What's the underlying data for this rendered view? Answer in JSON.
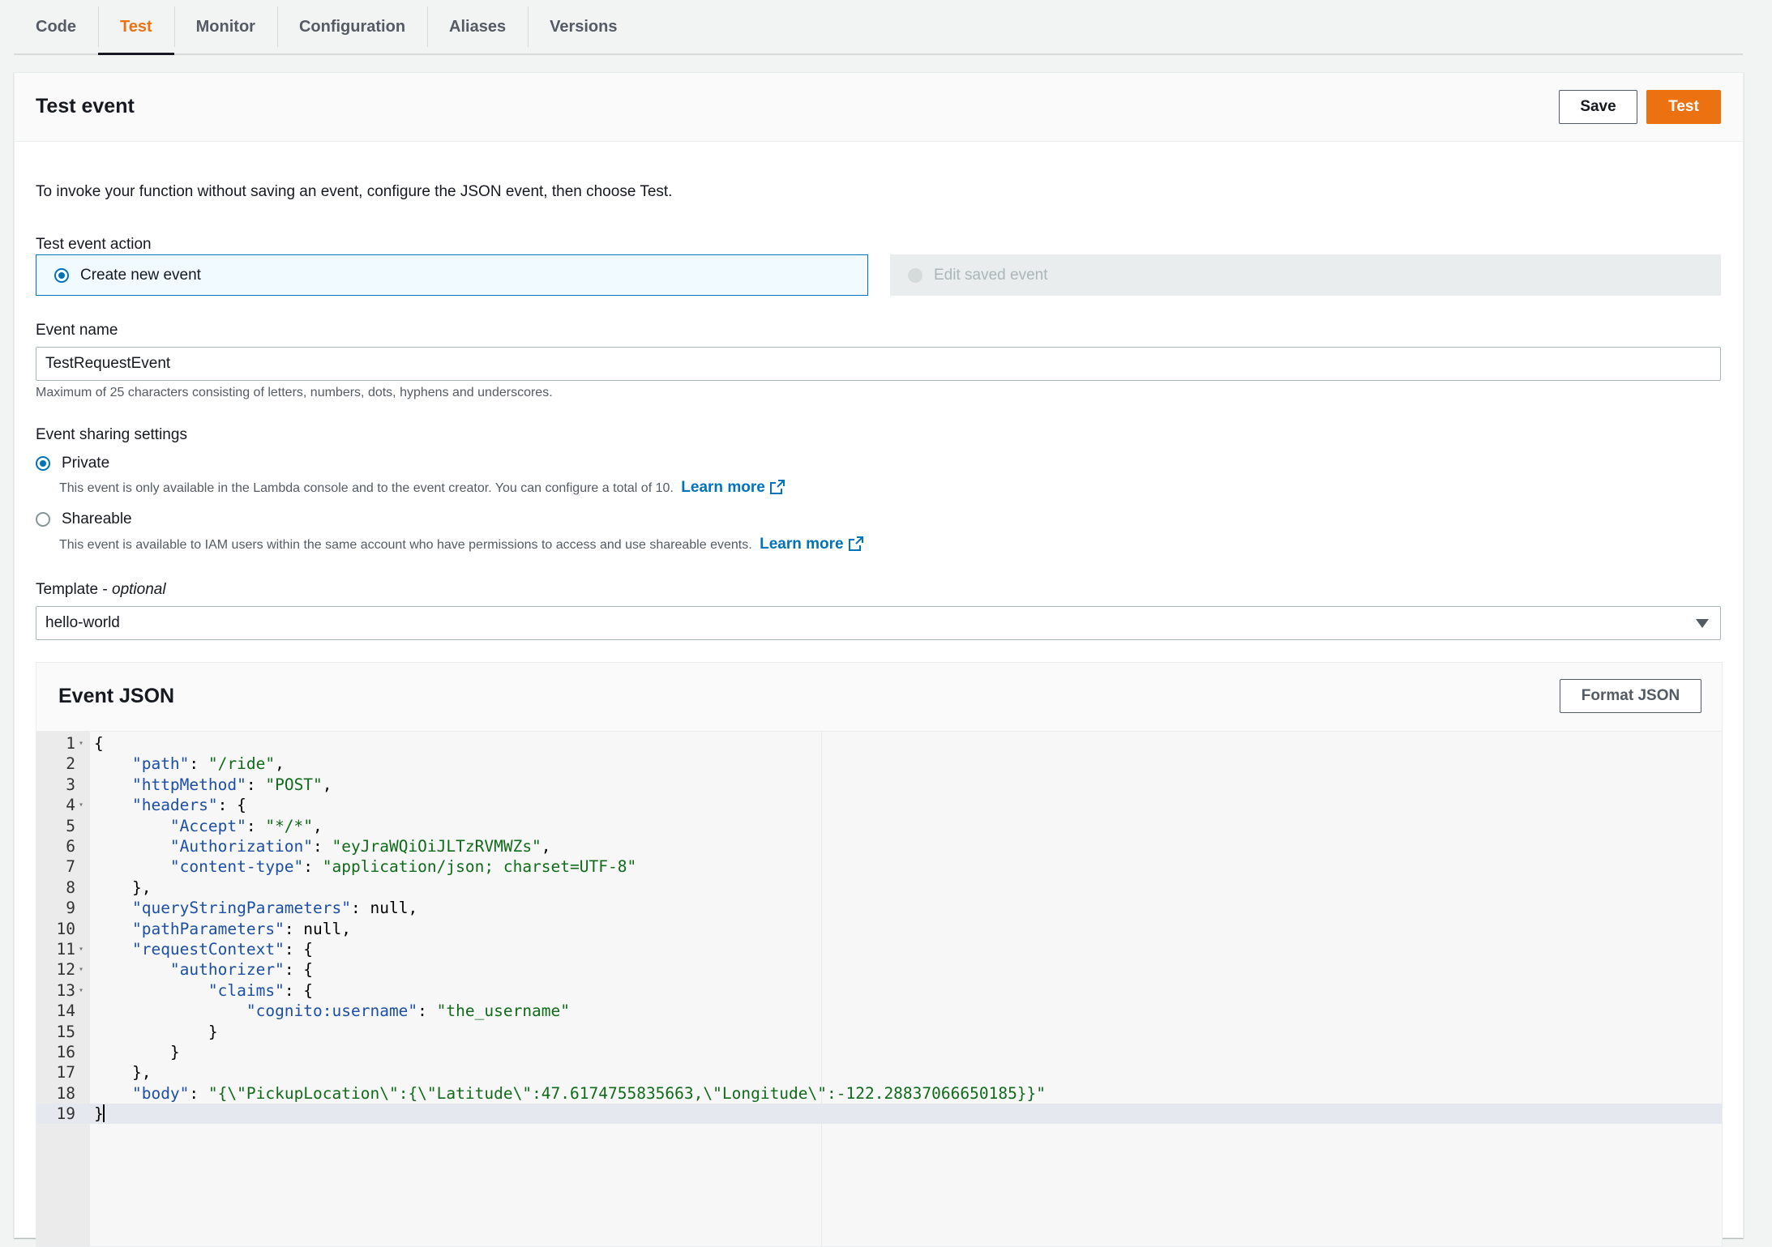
{
  "tabs": [
    {
      "label": "Code"
    },
    {
      "label": "Test",
      "active": true
    },
    {
      "label": "Monitor"
    },
    {
      "label": "Configuration"
    },
    {
      "label": "Aliases"
    },
    {
      "label": "Versions"
    }
  ],
  "panel": {
    "title": "Test event",
    "save_label": "Save",
    "test_label": "Test",
    "intro": "To invoke your function without saving an event, configure the JSON event, then choose Test."
  },
  "test_event_action": {
    "label": "Test event action",
    "create_new": "Create new event",
    "edit_saved": "Edit saved event",
    "selected": "Create new event"
  },
  "event_name": {
    "label": "Event name",
    "value": "TestRequestEvent",
    "hint": "Maximum of 25 characters consisting of letters, numbers, dots, hyphens and underscores."
  },
  "sharing": {
    "label": "Event sharing settings",
    "private_label": "Private",
    "private_desc": "This event is only available in the Lambda console and to the event creator. You can configure a total of 10.",
    "shareable_label": "Shareable",
    "shareable_desc": "This event is available to IAM users within the same account who have permissions to access and use shareable events.",
    "learn_more": "Learn more",
    "selected": "Private"
  },
  "template": {
    "label": "Template",
    "label_suffix": "optional",
    "value": "hello-world"
  },
  "event_json": {
    "title": "Event JSON",
    "format_label": "Format JSON",
    "active_line": 19,
    "lines": [
      {
        "n": "1",
        "fold": true,
        "indent": 0,
        "parts": [
          [
            "p",
            "{"
          ]
        ]
      },
      {
        "n": "2",
        "indent": 1,
        "parts": [
          [
            "k",
            "\"path\""
          ],
          [
            "p",
            ": "
          ],
          [
            "s",
            "\"/ride\""
          ],
          [
            "p",
            ","
          ]
        ]
      },
      {
        "n": "3",
        "indent": 1,
        "parts": [
          [
            "k",
            "\"httpMethod\""
          ],
          [
            "p",
            ": "
          ],
          [
            "s",
            "\"POST\""
          ],
          [
            "p",
            ","
          ]
        ]
      },
      {
        "n": "4",
        "fold": true,
        "indent": 1,
        "parts": [
          [
            "k",
            "\"headers\""
          ],
          [
            "p",
            ": {"
          ]
        ]
      },
      {
        "n": "5",
        "indent": 2,
        "parts": [
          [
            "k",
            "\"Accept\""
          ],
          [
            "p",
            ": "
          ],
          [
            "s",
            "\"*/*\""
          ],
          [
            "p",
            ","
          ]
        ]
      },
      {
        "n": "6",
        "indent": 2,
        "parts": [
          [
            "k",
            "\"Authorization\""
          ],
          [
            "p",
            ": "
          ],
          [
            "s",
            "\"eyJraWQiOiJLTzRVMWZs\""
          ],
          [
            "p",
            ","
          ]
        ]
      },
      {
        "n": "7",
        "indent": 2,
        "parts": [
          [
            "k",
            "\"content-type\""
          ],
          [
            "p",
            ": "
          ],
          [
            "s",
            "\"application/json; charset=UTF-8\""
          ]
        ]
      },
      {
        "n": "8",
        "indent": 1,
        "parts": [
          [
            "p",
            "},"
          ]
        ]
      },
      {
        "n": "9",
        "indent": 1,
        "parts": [
          [
            "k",
            "\"queryStringParameters\""
          ],
          [
            "p",
            ": null,"
          ]
        ]
      },
      {
        "n": "10",
        "indent": 1,
        "parts": [
          [
            "k",
            "\"pathParameters\""
          ],
          [
            "p",
            ": null,"
          ]
        ]
      },
      {
        "n": "11",
        "fold": true,
        "indent": 1,
        "parts": [
          [
            "k",
            "\"requestContext\""
          ],
          [
            "p",
            ": {"
          ]
        ]
      },
      {
        "n": "12",
        "fold": true,
        "indent": 2,
        "parts": [
          [
            "k",
            "\"authorizer\""
          ],
          [
            "p",
            ": {"
          ]
        ]
      },
      {
        "n": "13",
        "fold": true,
        "indent": 3,
        "parts": [
          [
            "k",
            "\"claims\""
          ],
          [
            "p",
            ": {"
          ]
        ]
      },
      {
        "n": "14",
        "indent": 4,
        "parts": [
          [
            "k",
            "\"cognito:username\""
          ],
          [
            "p",
            ": "
          ],
          [
            "s",
            "\"the_username\""
          ]
        ]
      },
      {
        "n": "15",
        "indent": 3,
        "parts": [
          [
            "p",
            "}"
          ]
        ]
      },
      {
        "n": "16",
        "indent": 2,
        "parts": [
          [
            "p",
            "}"
          ]
        ]
      },
      {
        "n": "17",
        "indent": 1,
        "parts": [
          [
            "p",
            "},"
          ]
        ]
      },
      {
        "n": "18",
        "indent": 1,
        "parts": [
          [
            "k",
            "\"body\""
          ],
          [
            "p",
            ": "
          ],
          [
            "s",
            "\"{\\\"PickupLocation\\\":{\\\"Latitude\\\":47.6174755835663,\\\"Longitude\\\":-122.28837066650185}}\""
          ]
        ]
      },
      {
        "n": "19",
        "indent": 0,
        "parts": [
          [
            "p",
            "}"
          ]
        ]
      }
    ]
  },
  "colors": {
    "accent": "#ec7211",
    "link": "#0073bb",
    "json_key": "#1c4fa5",
    "json_string": "#106b1a"
  }
}
